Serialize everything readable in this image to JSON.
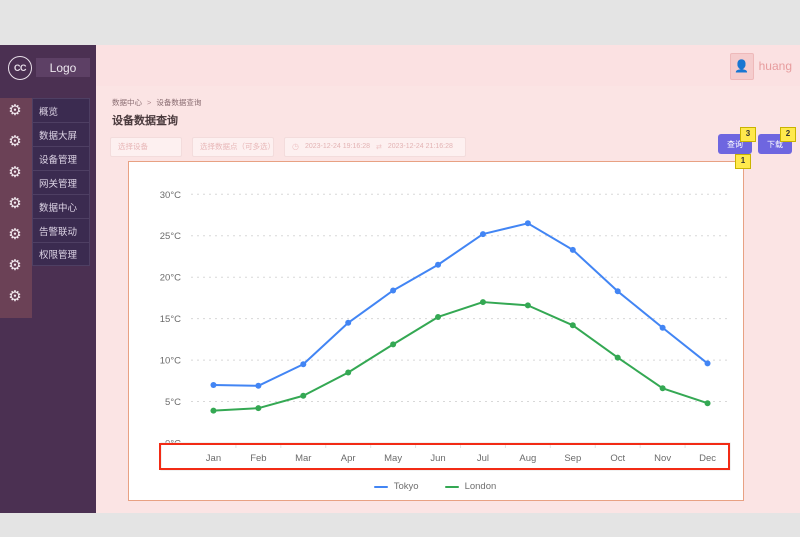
{
  "sidebar": {
    "logo_icon": "cc-circle-icon",
    "logo_text": "Logo",
    "items": [
      {
        "label": "概览",
        "icon": "gears-icon"
      },
      {
        "label": "数据大屏",
        "icon": "gears-icon"
      },
      {
        "label": "设备管理",
        "icon": "gears-icon"
      },
      {
        "label": "网关管理",
        "icon": "gears-icon"
      },
      {
        "label": "数据中心",
        "icon": "gears-icon"
      },
      {
        "label": "告警联动",
        "icon": "gears-icon"
      },
      {
        "label": "权限管理",
        "icon": "gears-icon"
      }
    ]
  },
  "topbar": {
    "avatar_icon": "user-avatar-icon",
    "username": "huang"
  },
  "breadcrumb": {
    "parent": "数据中心",
    "separator": ">",
    "current": "设备数据查询"
  },
  "page_title": "设备数据查询",
  "filters": {
    "device_placeholder": "选择设备",
    "datapoint_placeholder": "选择数据点（可多选）",
    "clock_icon": "clock-icon",
    "swap_icon": "swap-right-icon",
    "start_time": "2023-12-24 19:16:28",
    "end_time": "2023-12-24 21:16:28"
  },
  "actions": {
    "query_label": "查询",
    "query_badge": "3",
    "download_label": "下载",
    "download_badge": "2",
    "chart_badge": "1"
  },
  "colors": {
    "tokyo": "#4285f4",
    "london": "#34a853",
    "accent": "#6e66e0",
    "highlight": "#f22b15",
    "badge": "#ffe94d",
    "sidebar": "#4b3052"
  },
  "chart_data": {
    "type": "line",
    "title": "",
    "xlabel": "",
    "ylabel": "",
    "categories": [
      "Jan",
      "Feb",
      "Mar",
      "Apr",
      "May",
      "Jun",
      "Jul",
      "Aug",
      "Sep",
      "Oct",
      "Nov",
      "Dec"
    ],
    "ytick_labels": [
      "0°C",
      "5°C",
      "10°C",
      "15°C",
      "20°C",
      "25°C",
      "30°C"
    ],
    "ytick_values": [
      0,
      5,
      10,
      15,
      20,
      25,
      30
    ],
    "ylim": [
      0,
      31
    ],
    "grid": true,
    "legend_position": "bottom",
    "series": [
      {
        "name": "Tokyo",
        "color": "#4285f4",
        "values": [
          7.0,
          6.9,
          9.5,
          14.5,
          18.4,
          21.5,
          25.2,
          26.5,
          23.3,
          18.3,
          13.9,
          9.6
        ]
      },
      {
        "name": "London",
        "color": "#34a853",
        "values": [
          3.9,
          4.2,
          5.7,
          8.5,
          11.9,
          15.2,
          17.0,
          16.6,
          14.2,
          10.3,
          6.6,
          4.8
        ]
      }
    ],
    "annotations": [
      {
        "name": "x-axis-highlight-box",
        "color": "#f22b15"
      }
    ]
  }
}
